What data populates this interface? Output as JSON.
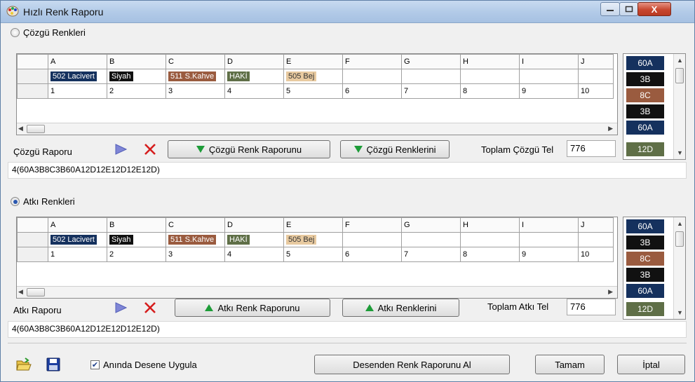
{
  "window": {
    "title": "Hızlı Renk Raporu",
    "close_label": "X"
  },
  "warp": {
    "radio_label": "Çözgü Renkleri",
    "columns": [
      "A",
      "B",
      "C",
      "D",
      "E",
      "F",
      "G",
      "H",
      "I",
      "J"
    ],
    "colors": [
      {
        "label": "502 Lacivert",
        "bg": "#15315e",
        "fg": "#ffffff"
      },
      {
        "label": "Siyah",
        "bg": "#111111",
        "fg": "#ffffff"
      },
      {
        "label": "511 S.Kahve",
        "bg": "#9a5b3f",
        "fg": "#ffffff"
      },
      {
        "label": "HAKİ",
        "bg": "#5f6f47",
        "fg": "#ffffff"
      },
      {
        "label": "505 Bej",
        "bg": "#e8caa0",
        "fg": "#333333"
      }
    ],
    "numbers": [
      "1",
      "2",
      "3",
      "4",
      "5",
      "6",
      "7",
      "8",
      "9",
      "10"
    ],
    "report_label": "Çözgü Raporu",
    "btn_report": "Çözgü Renk Raporunu",
    "btn_colors": "Çözgü Renklerini",
    "total_label": "Toplam Çözgü Tel",
    "total_value": "776",
    "formula": "4(60A3B8C3B60A12D12E12D12E12D)",
    "list": [
      {
        "label": "60A",
        "bg": "#15315e"
      },
      {
        "label": "3B",
        "bg": "#111111"
      },
      {
        "label": "8C",
        "bg": "#9a5b3f"
      },
      {
        "label": "3B",
        "bg": "#111111"
      },
      {
        "label": "60A",
        "bg": "#15315e"
      },
      {
        "label": "12D",
        "bg": "#5f6f47"
      }
    ]
  },
  "weft": {
    "radio_label": "Atkı Renkleri",
    "columns": [
      "A",
      "B",
      "C",
      "D",
      "E",
      "F",
      "G",
      "H",
      "I",
      "J"
    ],
    "colors": [
      {
        "label": "502 Lacivert",
        "bg": "#15315e",
        "fg": "#ffffff"
      },
      {
        "label": "Siyah",
        "bg": "#111111",
        "fg": "#ffffff"
      },
      {
        "label": "511 S.Kahve",
        "bg": "#9a5b3f",
        "fg": "#ffffff"
      },
      {
        "label": "HAKİ",
        "bg": "#5f6f47",
        "fg": "#ffffff"
      },
      {
        "label": "505 Bej",
        "bg": "#e8caa0",
        "fg": "#333333"
      }
    ],
    "numbers": [
      "1",
      "2",
      "3",
      "4",
      "5",
      "6",
      "7",
      "8",
      "9",
      "10"
    ],
    "report_label": "Atkı Raporu",
    "btn_report": "Atkı Renk Raporunu",
    "btn_colors": "Atkı Renklerini",
    "total_label": "Toplam Atkı Tel",
    "total_value": "776",
    "formula": "4(60A3B8C3B60A12D12E12D12E12D)",
    "list": [
      {
        "label": "60A",
        "bg": "#15315e"
      },
      {
        "label": "3B",
        "bg": "#111111"
      },
      {
        "label": "8C",
        "bg": "#9a5b3f"
      },
      {
        "label": "3B",
        "bg": "#111111"
      },
      {
        "label": "60A",
        "bg": "#15315e"
      },
      {
        "label": "12D",
        "bg": "#5f6f47"
      }
    ]
  },
  "footer": {
    "apply_label": "Anında Desene Uygula",
    "apply_checked": true,
    "btn_get": "Desenden Renk Raporunu Al",
    "btn_ok": "Tamam",
    "btn_cancel": "İptal"
  },
  "icons": {
    "app": "palette-icon",
    "play": "play-triangle-icon",
    "delete": "red-x-icon",
    "down": "green-down-triangle-icon",
    "up": "green-up-triangle-icon",
    "open": "open-folder-icon",
    "save": "save-disk-icon"
  }
}
